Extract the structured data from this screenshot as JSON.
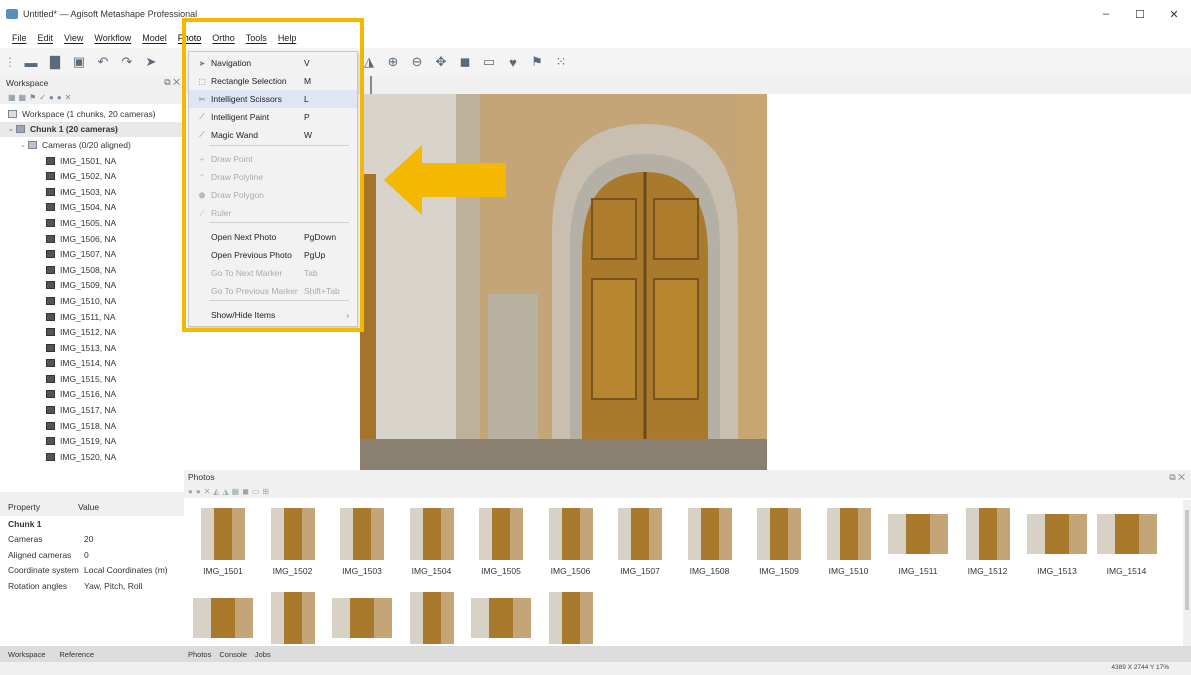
{
  "window": {
    "title": "Untitled* — Agisoft Metashape Professional",
    "controls": [
      "–",
      "☐",
      "✕"
    ]
  },
  "menubar": {
    "items": [
      "File",
      "Edit",
      "View",
      "Workflow",
      "Model",
      "Photo",
      "Ortho",
      "Tools",
      "Help"
    ],
    "active": "Photo"
  },
  "workspace": {
    "header": "Workspace",
    "tree": {
      "root": "Workspace (1 chunks, 20 cameras)",
      "chunk": "Chunk 1 (20 cameras)",
      "cameras_group": "Cameras (0/20 aligned)",
      "cameras": [
        "IMG_1501, NA",
        "IMG_1502, NA",
        "IMG_1503, NA",
        "IMG_1504, NA",
        "IMG_1505, NA",
        "IMG_1506, NA",
        "IMG_1507, NA",
        "IMG_1508, NA",
        "IMG_1509, NA",
        "IMG_1510, NA",
        "IMG_1511, NA",
        "IMG_1512, NA",
        "IMG_1513, NA",
        "IMG_1514, NA",
        "IMG_1515, NA",
        "IMG_1516, NA",
        "IMG_1517, NA",
        "IMG_1518, NA",
        "IMG_1519, NA",
        "IMG_1520, NA"
      ]
    }
  },
  "properties": {
    "col_property": "Property",
    "col_value": "Value",
    "section": "Chunk 1",
    "rows": [
      {
        "k": "Cameras",
        "v": "20"
      },
      {
        "k": "Aligned cameras",
        "v": "0"
      },
      {
        "k": "Coordinate system",
        "v": "Local Coordinates (m)"
      },
      {
        "k": "Rotation angles",
        "v": "Yaw, Pitch, Roll"
      }
    ]
  },
  "left_tabs": [
    "Workspace",
    "Reference"
  ],
  "photo_menu": {
    "items": [
      {
        "icon": "arrow",
        "label": "Navigation",
        "key": "V",
        "disabled": false
      },
      {
        "icon": "rect",
        "label": "Rectangle Selection",
        "key": "M",
        "disabled": false
      },
      {
        "icon": "scissors",
        "label": "Intelligent Scissors",
        "key": "L",
        "disabled": false,
        "highlight": true
      },
      {
        "icon": "brush",
        "label": "Intelligent Paint",
        "key": "P",
        "disabled": false
      },
      {
        "icon": "wand",
        "label": "Magic Wand",
        "key": "W",
        "disabled": false
      },
      {
        "icon": "point",
        "label": "Draw Point",
        "key": "",
        "disabled": true
      },
      {
        "icon": "polyline",
        "label": "Draw Polyline",
        "key": "",
        "disabled": true
      },
      {
        "icon": "polygon",
        "label": "Draw Polygon",
        "key": "",
        "disabled": true
      },
      {
        "icon": "ruler",
        "label": "Ruler",
        "key": "",
        "disabled": true
      },
      {
        "icon": "",
        "label": "Open Next Photo",
        "key": "PgDown",
        "disabled": false
      },
      {
        "icon": "",
        "label": "Open Previous Photo",
        "key": "PgUp",
        "disabled": false
      },
      {
        "icon": "",
        "label": "Go To Next Marker",
        "key": "Tab",
        "disabled": true
      },
      {
        "icon": "",
        "label": "Go To Previous Marker",
        "key": "Shift+Tab",
        "disabled": true
      },
      {
        "icon": "",
        "label": "Show/Hide Items",
        "key": "",
        "disabled": false,
        "submenu": true
      }
    ]
  },
  "photos_panel": {
    "header": "Photos",
    "thumbnails": [
      "IMG_1501",
      "IMG_1502",
      "IMG_1503",
      "IMG_1504",
      "IMG_1505",
      "IMG_1506",
      "IMG_1507",
      "IMG_1508",
      "IMG_1509",
      "IMG_1510",
      "IMG_1511",
      "IMG_1512",
      "IMG_1513",
      "IMG_1514"
    ]
  },
  "bottom_tabs": [
    "Photos",
    "Console",
    "Jobs"
  ],
  "status": "4389 X  2744 Y  17%",
  "colors": {
    "highlight_box": "#f5b800",
    "arrow": "#f5b800"
  }
}
